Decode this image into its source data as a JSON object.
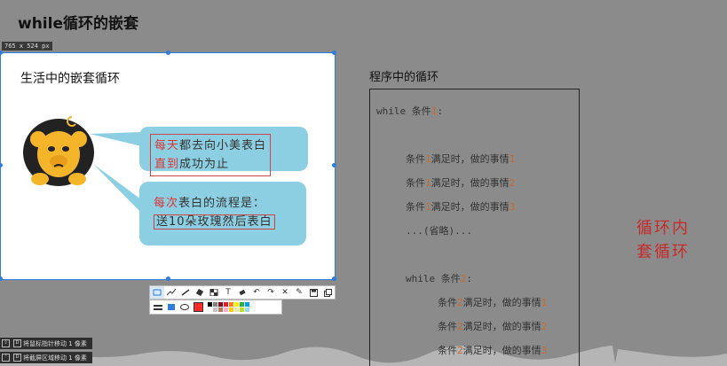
{
  "page": {
    "title": "while循环的嵌套"
  },
  "capture": {
    "size_badge": "765 x 524  px",
    "life_title": "生活中的嵌套循环",
    "bubble1": {
      "red_a": "每天",
      "text_a": "都去向小美表白",
      "red_b": "直到",
      "text_b": "成功为止"
    },
    "bubble2": {
      "red_a": "每次",
      "text_a": "表白的流程是：",
      "text_b": "送10朵玫瑰然后表白"
    }
  },
  "code": {
    "title": "程序中的循环",
    "line1": {
      "kw": "while",
      "cond": "条件",
      "num": "1",
      "tail": ":"
    },
    "rows_outer": [
      {
        "a": "条件",
        "n": "1",
        "b": "满足时，做的事情",
        "m": "1"
      },
      {
        "a": "条件",
        "n": "1",
        "b": "满足时，做的事情",
        "m": "2"
      },
      {
        "a": "条件",
        "n": "1",
        "b": "满足时，做的事情",
        "m": "3"
      }
    ],
    "ellipsis": "...(省略)...",
    "line2": {
      "kw": "while",
      "cond": "条件",
      "num": "2",
      "tail": ":"
    },
    "rows_inner": [
      {
        "a": "条件",
        "n": "2",
        "b": "满足时，做的事情",
        "m": "1"
      },
      {
        "a": "条件",
        "n": "2",
        "b": "满足时，做的事情",
        "m": "2"
      },
      {
        "a": "条件",
        "n": "2",
        "b": "满足时，做的事情",
        "m": "3"
      }
    ]
  },
  "side_note": {
    "line1": "循环内",
    "line2": "套循环"
  },
  "statusbar": {
    "hint1": "将鼠标指针移动 1 像素",
    "hint2": "将截屏区域移动 1 像素"
  },
  "toolbar": {
    "tools": [
      "rect-icon",
      "line-icon",
      "pen-icon",
      "marker-icon",
      "mosaic-icon",
      "text-icon",
      "eraser-icon",
      "undo-icon",
      "redo-icon",
      "close-icon",
      "pin-icon",
      "save-icon",
      "copy-icon"
    ],
    "palette": [
      "#000000",
      "#7f7f7f",
      "#880015",
      "#ed1c24",
      "#ff7f27",
      "#fff200",
      "#22b14c",
      "#00a2e8",
      "#ffffff",
      "#c3c3c3",
      "#b97a57",
      "#ffaec9",
      "#ffc90e",
      "#efe4b0",
      "#b5e61d",
      "#99d9ea"
    ],
    "selected_color": "#ff2a2a"
  },
  "colors": {
    "accent": "#2d7de0",
    "note_red": "#c62a2a",
    "bubble": "#8ccfe3"
  }
}
